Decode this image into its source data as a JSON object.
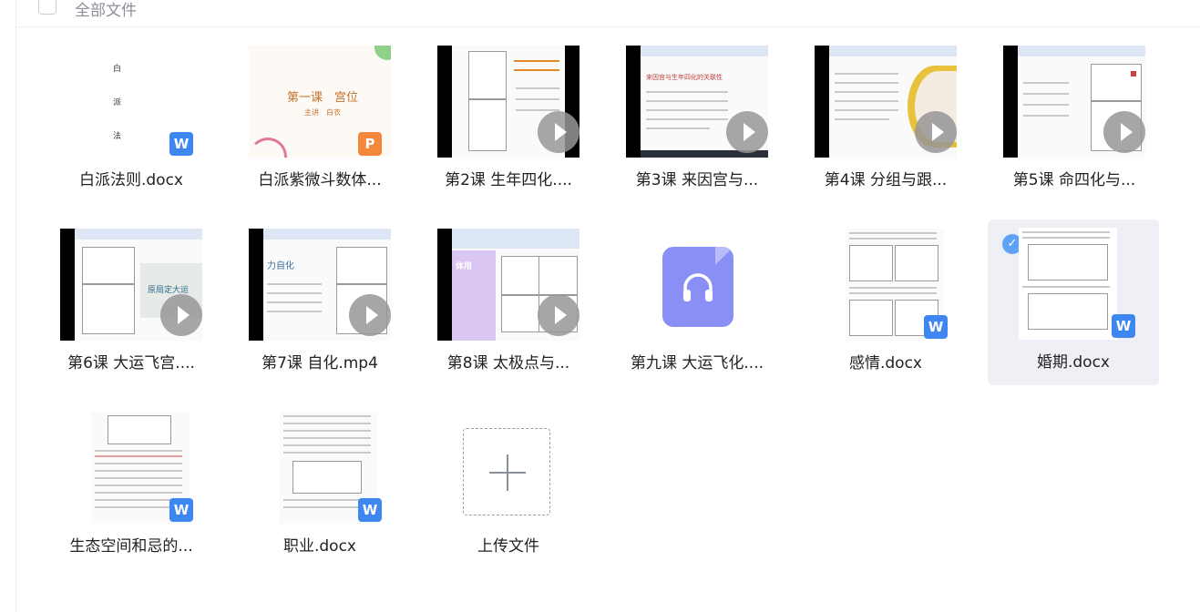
{
  "header": {
    "title": "全部文件"
  },
  "files": [
    {
      "name": "白派法则.docx",
      "type": "docx",
      "badge": "W"
    },
    {
      "name": "白派紫微斗数体...",
      "type": "ppt",
      "badge": "P",
      "slide_title": "第一课　宫位",
      "slide_sub": "主讲　白衣"
    },
    {
      "name": "第2课 生年四化....",
      "type": "video"
    },
    {
      "name": "第3课 来因宫与...",
      "type": "video",
      "slide_title": "来因宫与生年四化的关联性"
    },
    {
      "name": "第4课 分组与跟...",
      "type": "video"
    },
    {
      "name": "第5课 命四化与...",
      "type": "video"
    },
    {
      "name": "第6课 大运飞宫....",
      "type": "video",
      "slide_title": "原局定大运"
    },
    {
      "name": "第7课 自化.mp4",
      "type": "video",
      "slide_title": "力自化"
    },
    {
      "name": "第8课 太极点与...",
      "type": "video",
      "slide_title": "体用"
    },
    {
      "name": "第九课 大运飞化....",
      "type": "audio"
    },
    {
      "name": "感情.docx",
      "type": "docx",
      "badge": "W"
    },
    {
      "name": "婚期.docx",
      "type": "docx",
      "badge": "W",
      "selected": true,
      "check": "✓"
    },
    {
      "name": "生态空间和忌的...",
      "type": "docx",
      "badge": "W"
    },
    {
      "name": "职业.docx",
      "type": "docx",
      "badge": "W"
    }
  ],
  "upload": {
    "label": "上传文件"
  },
  "colors": {
    "word_badge": "#3e86f0",
    "ppt_badge": "#f5873a",
    "audio": "#8a8ff5",
    "selected_bg": "#eef0f6",
    "check": "#5ea3f5"
  }
}
